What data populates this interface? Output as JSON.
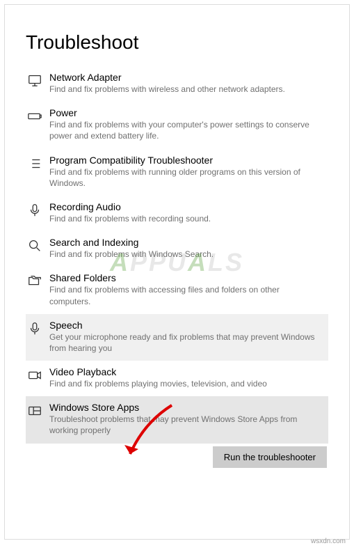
{
  "page": {
    "title": "Troubleshoot"
  },
  "items": [
    {
      "title": "Network Adapter",
      "desc": "Find and fix problems with wireless and other network adapters."
    },
    {
      "title": "Power",
      "desc": "Find and fix problems with your computer's power settings to conserve power and extend battery life."
    },
    {
      "title": "Program Compatibility Troubleshooter",
      "desc": "Find and fix problems with running older programs on this version of Windows."
    },
    {
      "title": "Recording Audio",
      "desc": "Find and fix problems with recording sound."
    },
    {
      "title": "Search and Indexing",
      "desc": "Find and fix problems with Windows Search."
    },
    {
      "title": "Shared Folders",
      "desc": "Find and fix problems with accessing files and folders on other computers."
    },
    {
      "title": "Speech",
      "desc": "Get your microphone ready and fix problems that may prevent Windows from hearing you"
    },
    {
      "title": "Video Playback",
      "desc": "Find and fix problems playing movies, television, and video"
    },
    {
      "title": "Windows Store Apps",
      "desc": "Troubleshoot problems that may prevent Windows Store Apps from working properly"
    }
  ],
  "button": {
    "run": "Run the troubleshooter"
  },
  "watermark": "APPUALS",
  "footer": "wsxdn.com"
}
